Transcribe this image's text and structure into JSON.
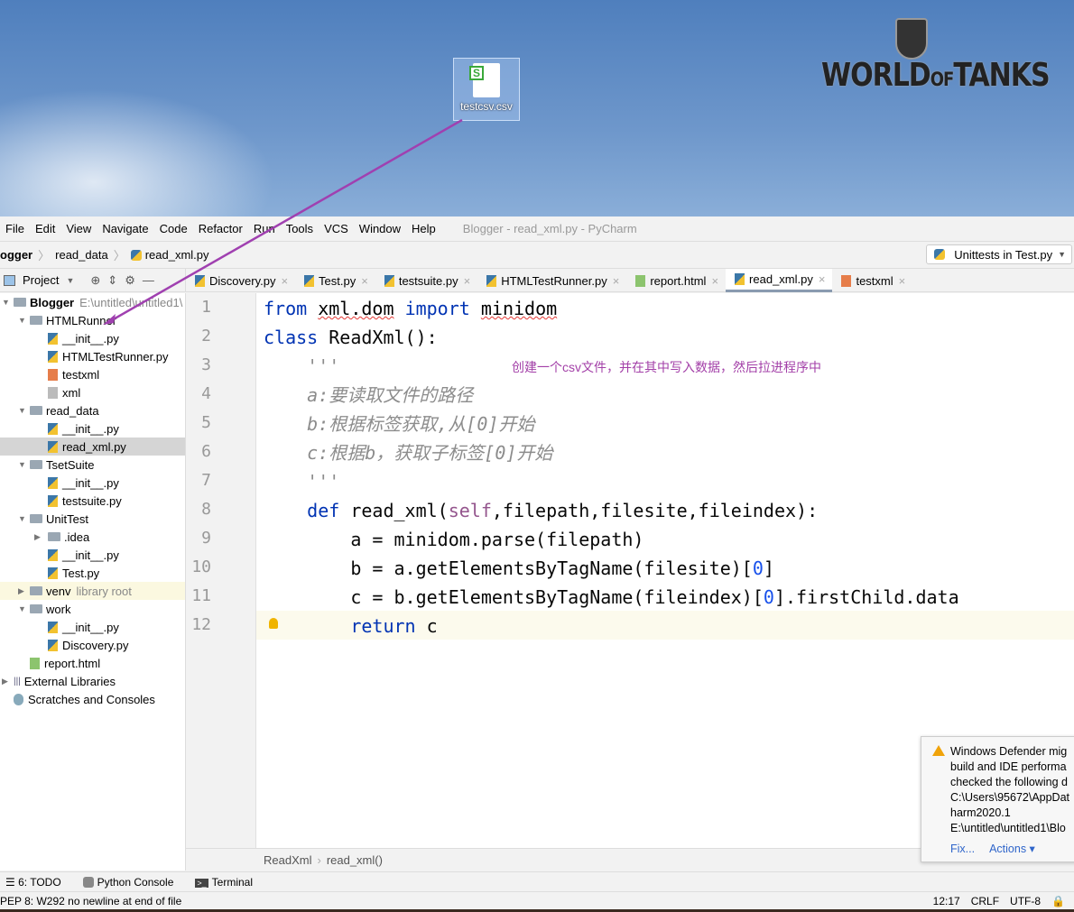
{
  "desktop": {
    "file_icon_label": "testcsv.csv",
    "logo_text": "WORLD OF TANKS"
  },
  "menu": [
    "File",
    "Edit",
    "View",
    "Navigate",
    "Code",
    "Refactor",
    "Run",
    "Tools",
    "VCS",
    "Window",
    "Help"
  ],
  "window_title": "Blogger - read_xml.py - PyCharm",
  "breadcrumb": [
    "ogger",
    "read_data",
    "read_xml.py"
  ],
  "run_config": "Unittests in Test.py",
  "project_label": "Project",
  "tabs": [
    {
      "label": "Discovery.py",
      "icon": "py"
    },
    {
      "label": "Test.py",
      "icon": "py"
    },
    {
      "label": "testsuite.py",
      "icon": "py"
    },
    {
      "label": "HTMLTestRunner.py",
      "icon": "py"
    },
    {
      "label": "report.html",
      "icon": "html"
    },
    {
      "label": "read_xml.py",
      "icon": "py",
      "active": true
    },
    {
      "label": "testxml",
      "icon": "xml"
    }
  ],
  "tree": [
    {
      "label": "Blogger",
      "extra": "E:\\untitled\\untitled1\\",
      "depth": 0,
      "type": "folder",
      "open": true,
      "bold": true
    },
    {
      "label": "HTMLRunner",
      "depth": 1,
      "type": "folder",
      "open": true
    },
    {
      "label": "__init__.py",
      "depth": 2,
      "type": "py"
    },
    {
      "label": "HTMLTestRunner.py",
      "depth": 2,
      "type": "py"
    },
    {
      "label": "testxml",
      "depth": 2,
      "type": "xml"
    },
    {
      "label": "xml",
      "depth": 2,
      "type": "txt"
    },
    {
      "label": "read_data",
      "depth": 1,
      "type": "folder",
      "open": true
    },
    {
      "label": "__init__.py",
      "depth": 2,
      "type": "py"
    },
    {
      "label": "read_xml.py",
      "depth": 2,
      "type": "py",
      "selected": true
    },
    {
      "label": "TsetSuite",
      "depth": 1,
      "type": "folder",
      "open": true
    },
    {
      "label": "__init__.py",
      "depth": 2,
      "type": "py"
    },
    {
      "label": "testsuite.py",
      "depth": 2,
      "type": "py"
    },
    {
      "label": "UnitTest",
      "depth": 1,
      "type": "folder",
      "open": true
    },
    {
      "label": ".idea",
      "depth": 2,
      "type": "folder",
      "open": false
    },
    {
      "label": "__init__.py",
      "depth": 2,
      "type": "py"
    },
    {
      "label": "Test.py",
      "depth": 2,
      "type": "py"
    },
    {
      "label": "venv",
      "extra": "library root",
      "depth": 1,
      "type": "folder",
      "open": false,
      "venv": true
    },
    {
      "label": "work",
      "depth": 1,
      "type": "folder",
      "open": true
    },
    {
      "label": "__init__.py",
      "depth": 2,
      "type": "py"
    },
    {
      "label": "Discovery.py",
      "depth": 2,
      "type": "py"
    },
    {
      "label": "report.html",
      "depth": 1,
      "type": "html"
    },
    {
      "label": "External Libraries",
      "depth": 0,
      "type": "lib",
      "open": false
    },
    {
      "label": "Scratches and Consoles",
      "depth": 0,
      "type": "scratch"
    }
  ],
  "code": [
    [
      [
        "kw",
        "from"
      ],
      [
        "id",
        " "
      ],
      [
        "sq",
        "xml.dom"
      ],
      [
        "id",
        " "
      ],
      [
        "kw",
        "import"
      ],
      [
        "id",
        " "
      ],
      [
        "sq",
        "minidom"
      ]
    ],
    [
      [
        "kw",
        "class"
      ],
      [
        "id",
        " ReadXml():"
      ]
    ],
    [
      [
        "id",
        "    "
      ],
      [
        "doc",
        "'''"
      ]
    ],
    [
      [
        "id",
        "    "
      ],
      [
        "doc",
        "a:要读取文件的路径"
      ]
    ],
    [
      [
        "id",
        "    "
      ],
      [
        "doc",
        "b:根据标签获取,从[0]开始"
      ]
    ],
    [
      [
        "id",
        "    "
      ],
      [
        "doc",
        "c:根据b，获取子标签[0]开始"
      ]
    ],
    [
      [
        "id",
        "    "
      ],
      [
        "doc",
        "'''"
      ]
    ],
    [
      [
        "id",
        "    "
      ],
      [
        "kw",
        "def"
      ],
      [
        "id",
        " read_xml("
      ],
      [
        "slf",
        "self"
      ],
      [
        "id",
        ",filepath,filesite,fileindex):"
      ]
    ],
    [
      [
        "id",
        "        a = minidom.parse(filepath)"
      ]
    ],
    [
      [
        "id",
        "        b = a.getElementsByTagName(filesite)["
      ],
      [
        "num",
        "0"
      ],
      [
        "id",
        "]"
      ]
    ],
    [
      [
        "id",
        "        c = b.getElementsByTagName(fileindex)["
      ],
      [
        "num",
        "0"
      ],
      [
        "id",
        "].firstChild.data"
      ]
    ],
    [
      [
        "id",
        "        "
      ],
      [
        "kw",
        "return"
      ],
      [
        "id",
        " c"
      ]
    ]
  ],
  "annotation": "创建一个csv文件，并在其中写入数据，然后拉进程序中",
  "code_breadcrumb": [
    "ReadXml",
    "read_xml()"
  ],
  "tool_windows": [
    "6: TODO",
    "Python Console",
    "Terminal"
  ],
  "status_message": "PEP 8: W292 no newline at end of file",
  "status_right": [
    "12:17",
    "CRLF",
    "UTF-8"
  ],
  "notification": {
    "lines": [
      "Windows Defender mig",
      "build and IDE performa",
      "checked the following d",
      "C:\\Users\\95672\\AppDat",
      "harm2020.1",
      "E:\\untitled\\untitled1\\Blo"
    ],
    "fix": "Fix...",
    "actions": "Actions ▾"
  },
  "colors": {
    "keyword": "#0033b3",
    "docstring": "#8c8c8c",
    "annotation": "#a340a8",
    "self": "#94558d"
  }
}
